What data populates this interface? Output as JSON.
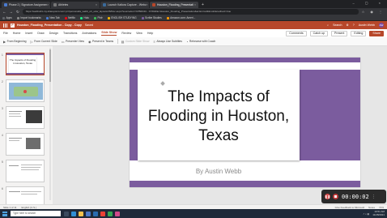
{
  "browser": {
    "tabs": [
      {
        "label": "Phase 2 | Signature Assignmen",
        "color": "#4a7bd0",
        "active": false
      },
      {
        "label": "Athletes",
        "color": "#3a3a3a",
        "active": false
      },
      {
        "label": "Launch Kaltura Capture - Webc",
        "color": "#3a6a9a",
        "active": false
      },
      {
        "label": "Houston_Flooding_Presentati",
        "color": "#b7472a",
        "active": true
      }
    ],
    "url": "https://webbu01-my.sharepoint.com/:p:/r/personal/a_webb_uh_edu/_layouts/15/Doc.aspx?sourcedoc=%7B0D4C...%7D&file=Houston_Flooding_Presentation&action=edit&mobileredirect=true",
    "bookmarks": [
      {
        "label": "Apps",
        "color": "#5f6368"
      },
      {
        "label": "Import bookmarks",
        "color": "#888888"
      },
      {
        "label": "New Tab",
        "color": "#4a7bd0"
      },
      {
        "label": "Netflix",
        "color": "#e50914"
      },
      {
        "label": "Hulu",
        "color": "#1ce783"
      },
      {
        "label": "Pixlr",
        "color": "#3cba54"
      },
      {
        "label": "ENGLISH STUDYING",
        "color": "#f4b400"
      },
      {
        "label": "Scribe Studies",
        "color": "#7b5c9e"
      },
      {
        "label": "Amazon.com: Ameri...",
        "color": "#ff9900"
      }
    ]
  },
  "office": {
    "doc_title": "Houston_Flooding_Presentation - Copy - Copy",
    "saved_state": "Saved",
    "search_placeholder": "Search",
    "user_name": "Austin Webb",
    "user_initials": "AW"
  },
  "ribbon": {
    "tabs": [
      "File",
      "Home",
      "Insert",
      "Draw",
      "Design",
      "Transitions",
      "Animations",
      "Slide Show",
      "Review",
      "View",
      "Help"
    ],
    "active_tab": "Slide Show",
    "right": {
      "comments": "Comments",
      "catchup": "Catch up",
      "present": "Present",
      "editing": "Editing",
      "share": "Share"
    },
    "commands": [
      {
        "label": "From Beginning",
        "icon": "▶",
        "disabled": false
      },
      {
        "label": "From Current Slide",
        "icon": "▷",
        "disabled": false
      },
      {
        "label": "Presenter View",
        "icon": "▭",
        "disabled": false
      },
      {
        "label": "Present in Teams",
        "icon": "◉",
        "disabled": false
      },
      {
        "label": "Custom Slide Show",
        "icon": "▤",
        "disabled": true
      },
      {
        "label": "Always Use Subtitles",
        "icon": "≡",
        "disabled": false
      },
      {
        "label": "Rehearse with Coach",
        "icon": "◔",
        "disabled": false
      }
    ]
  },
  "thumbnails": [
    {
      "num": "1",
      "title": "The Impacts of Flooding in Houston, Texas"
    },
    {
      "num": "2",
      "title": ""
    },
    {
      "num": "3",
      "title": ""
    },
    {
      "num": "4",
      "title": ""
    },
    {
      "num": "5",
      "title": ""
    },
    {
      "num": "6",
      "title": ""
    }
  ],
  "slide": {
    "title": "The Impacts of Flooding in Houston, Texas",
    "subtitle": "By Austin Webb",
    "accent_color": "#7b5c9e"
  },
  "status": {
    "slide_counter": "Slide 1 of 11",
    "language": "English (U.S.)",
    "feedback": "Give Feedback to Microsoft",
    "notes": "Notes",
    "zoom": "72%"
  },
  "recorder": {
    "time": "00:00:02"
  },
  "taskbar": {
    "search_placeholder": "Type here to search",
    "time": "10:51 AM",
    "date": "11/28/2021"
  }
}
